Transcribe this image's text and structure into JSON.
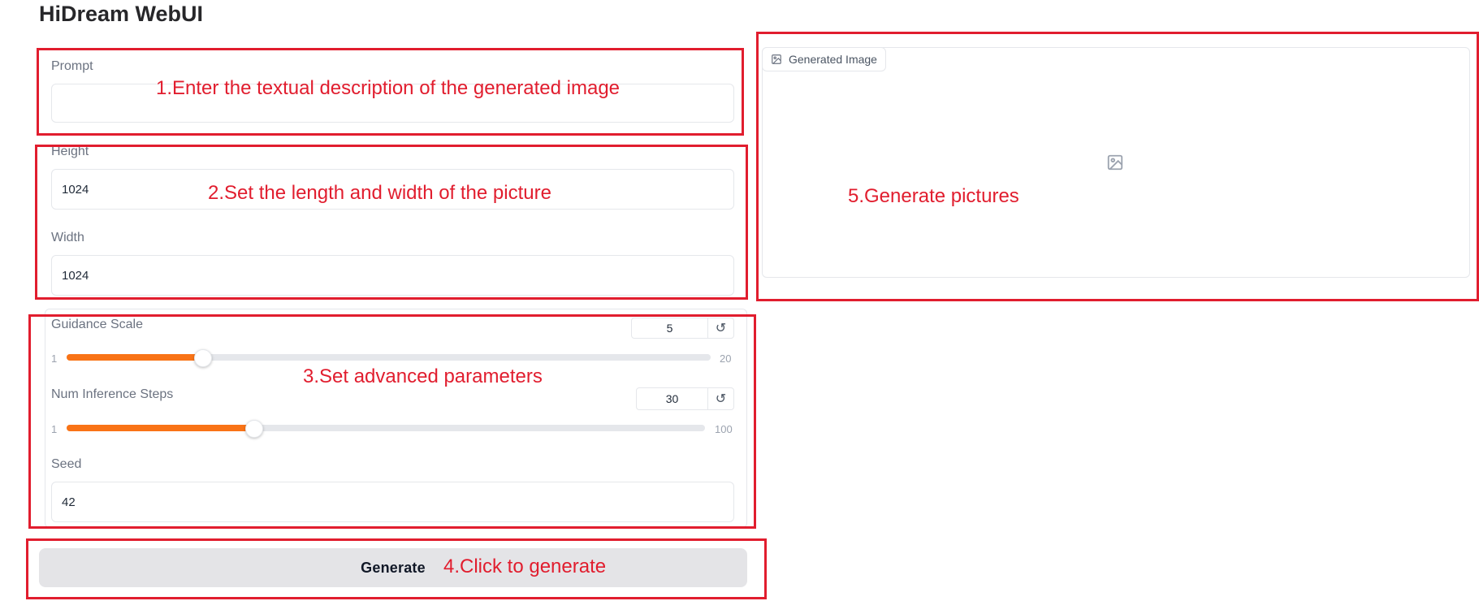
{
  "app": {
    "title": "HiDream WebUI"
  },
  "prompt": {
    "label": "Prompt",
    "value": ""
  },
  "height": {
    "label": "Height",
    "value": "1024"
  },
  "width": {
    "label": "Width",
    "value": "1024"
  },
  "guidance": {
    "label": "Guidance Scale",
    "value": "5",
    "min": "1",
    "max": "20",
    "fraction": 0.2105
  },
  "steps": {
    "label": "Num Inference Steps",
    "value": "30",
    "min": "1",
    "max": "100",
    "fraction": 0.293
  },
  "seed": {
    "label": "Seed",
    "value": "42"
  },
  "generate": {
    "label": "Generate"
  },
  "output": {
    "tab_label": "Generated Image"
  },
  "icons": {
    "reset": "reset-icon",
    "image": "image-icon"
  },
  "annotations": {
    "a1": "1.Enter the textual description of the generated image",
    "a2": "2.Set the length and width of the picture",
    "a3": "3.Set advanced parameters",
    "a4": "4.Click to generate",
    "a5": "5.Generate pictures"
  },
  "colors": {
    "accent": "#f97316",
    "annotation": "#e11d2e",
    "button_bg": "#e4e4e7"
  }
}
